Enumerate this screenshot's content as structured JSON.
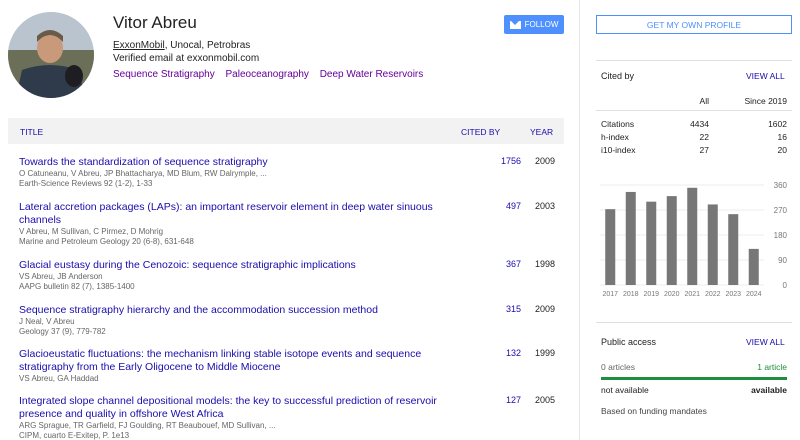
{
  "profile": {
    "name": "Vitor Abreu",
    "primary_org": "ExxonMobil",
    "other_orgs": ", Unocal, Petrobras",
    "email": "Verified email at exxonmobil.com",
    "interests": [
      "Sequence Stratigraphy",
      "Paleoceanography",
      "Deep Water Reservoirs"
    ],
    "follow_label": "FOLLOW"
  },
  "table": {
    "title_header": "TITLE",
    "cited_header": "CITED BY",
    "year_header": "YEAR"
  },
  "articles": [
    {
      "title": "Towards the standardization of sequence stratigraphy",
      "authors": "O Catuneanu, V Abreu, JP Bhattacharya, MD Blum, RW Dalrymple, ...",
      "venue": "Earth-Science Reviews 92 (1-2), 1-33",
      "cited_by": "1756",
      "year": "2009"
    },
    {
      "title": "Lateral accretion packages (LAPs): an important reservoir element in deep water sinuous channels",
      "authors": "V Abreu, M Sullivan, C Pirmez, D Mohrig",
      "venue": "Marine and Petroleum Geology 20 (6-8), 631-648",
      "cited_by": "497",
      "year": "2003"
    },
    {
      "title": "Glacial eustasy during the Cenozoic: sequence stratigraphic implications",
      "authors": "VS Abreu, JB Anderson",
      "venue": "AAPG bulletin 82 (7), 1385-1400",
      "cited_by": "367",
      "year": "1998"
    },
    {
      "title": "Sequence stratigraphy hierarchy and the accommodation succession method",
      "authors": "J Neal, V Abreu",
      "venue": "Geology 37 (9), 779-782",
      "cited_by": "315",
      "year": "2009"
    },
    {
      "title": "Glacioeustatic fluctuations: the mechanism linking stable isotope events and sequence stratigraphy from the Early Oligocene to Middle Miocene",
      "authors": "VS Abreu, GA Haddad",
      "venue": "",
      "cited_by": "132",
      "year": "1999"
    },
    {
      "title": "Integrated slope channel depositional models: the key to successful prediction of reservoir presence and quality in offshore West Africa",
      "authors": "ARG Sprague, TR Garfield, FJ Goulding, RT Beaubouef, MD Sullivan, ...",
      "venue": "CIPM, cuarto E-Exitep, P. 1e13",
      "cited_by": "127",
      "year": "2005"
    }
  ],
  "sidebar": {
    "profile_button": "GET MY OWN PROFILE",
    "cited_by_title": "Cited by",
    "view_all": "VIEW ALL",
    "col_all": "All",
    "col_since": "Since 2019",
    "stats": [
      {
        "label": "Citations",
        "all": "4434",
        "since": "1602"
      },
      {
        "label": "h-index",
        "all": "22",
        "since": "16"
      },
      {
        "label": "i10-index",
        "all": "27",
        "since": "20"
      }
    ],
    "public_access_title": "Public access",
    "public_access_view_all": "VIEW ALL",
    "not_available_count": "0 articles",
    "available_count": "1 article",
    "not_available_label": "not available",
    "available_label": "available",
    "funding_note": "Based on funding mandates"
  },
  "chart_data": {
    "type": "bar",
    "categories": [
      "2017",
      "2018",
      "2019",
      "2020",
      "2021",
      "2022",
      "2023",
      "2024"
    ],
    "values": [
      273,
      335,
      300,
      320,
      350,
      290,
      255,
      130
    ],
    "yticks": [
      "360",
      "270",
      "180",
      "90",
      "0"
    ],
    "ylim": [
      0,
      360
    ],
    "bar_color": "#777777"
  },
  "colors": {
    "link": "#1a0dab",
    "interest": "#660099",
    "accent": "#4d90fe",
    "available_bar": "#1e8e3e"
  }
}
